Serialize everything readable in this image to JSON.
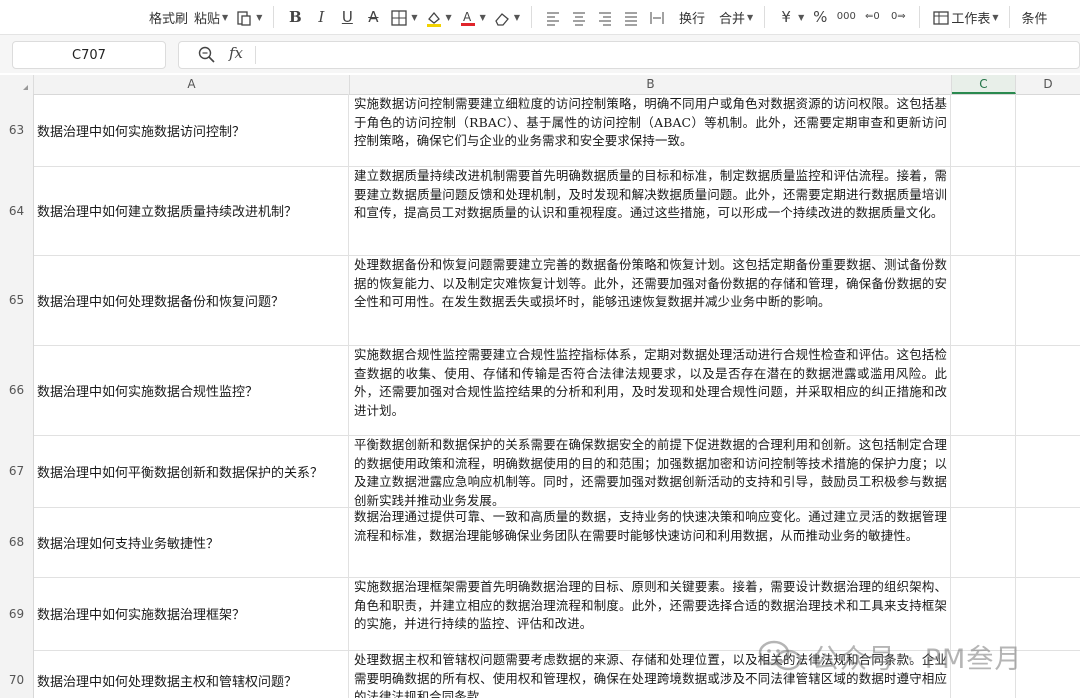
{
  "toolbar": {
    "format_painter": "格式刷",
    "paste": "粘贴",
    "wrap": "换行",
    "merge": "合并",
    "percent": "%",
    "worksheet": "工作表",
    "condition": "条件"
  },
  "formula_bar": {
    "name_box": "C707",
    "fx_label": "fx"
  },
  "columns": [
    "A",
    "B",
    "C",
    "D"
  ],
  "rows": [
    {
      "num": "63",
      "question": "数据治理中如何实施数据访问控制？",
      "answer": "实施数据访问控制需要建立细粒度的访问控制策略，明确不同用户或角色对数据资源的访问权限。这包括基于角色的访问控制（RBAC）、基于属性的访问控制（ABAC）等机制。此外，还需要定期审查和更新访问控制策略，确保它们与企业的业务需求和安全要求保持一致。"
    },
    {
      "num": "64",
      "question": "数据治理中如何建立数据质量持续改进机制？",
      "answer": "建立数据质量持续改进机制需要首先明确数据质量的目标和标准，制定数据质量监控和评估流程。接着，需要建立数据质量问题反馈和处理机制，及时发现和解决数据质量问题。此外，还需要定期进行数据质量培训和宣传，提高员工对数据质量的认识和重视程度。通过这些措施，可以形成一个持续改进的数据质量文化。"
    },
    {
      "num": "65",
      "question": "数据治理中如何处理数据备份和恢复问题？",
      "answer": "处理数据备份和恢复问题需要建立完善的数据备份策略和恢复计划。这包括定期备份重要数据、测试备份数据的恢复能力、以及制定灾难恢复计划等。此外，还需要加强对备份数据的存储和管理，确保备份数据的安全性和可用性。在发生数据丢失或损坏时，能够迅速恢复数据并减少业务中断的影响。"
    },
    {
      "num": "66",
      "question": "数据治理中如何实施数据合规性监控？",
      "answer": "实施数据合规性监控需要建立合规性监控指标体系，定期对数据处理活动进行合规性检查和评估。这包括检查数据的收集、使用、存储和传输是否符合法律法规要求，以及是否存在潜在的数据泄露或滥用风险。此外，还需要加强对合规性监控结果的分析和利用，及时发现和处理合规性问题，并采取相应的纠正措施和改进计划。"
    },
    {
      "num": "67",
      "question": "数据治理中如何平衡数据创新和数据保护的关系？",
      "answer": "平衡数据创新和数据保护的关系需要在确保数据安全的前提下促进数据的合理利用和创新。这包括制定合理的数据使用政策和流程，明确数据使用的目的和范围；加强数据加密和访问控制等技术措施的保护力度；以及建立数据泄露应急响应机制等。同时，还需要加强对数据创新活动的支持和引导，鼓励员工积极参与数据创新实践并推动业务发展。"
    },
    {
      "num": "68",
      "question": "数据治理如何支持业务敏捷性？",
      "answer": "数据治理通过提供可靠、一致和高质量的数据，支持业务的快速决策和响应变化。通过建立灵活的数据管理流程和标准，数据治理能够确保业务团队在需要时能够快速访问和利用数据，从而推动业务的敏捷性。"
    },
    {
      "num": "69",
      "question": "数据治理中如何实施数据治理框架？",
      "answer": "实施数据治理框架需要首先明确数据治理的目标、原则和关键要素。接着，需要设计数据治理的组织架构、角色和职责，并建立相应的数据治理流程和制度。此外，还需要选择合适的数据治理技术和工具来支持框架的实施，并进行持续的监控、评估和改进。"
    },
    {
      "num": "70",
      "question": "数据治理中如何处理数据主权和管辖权问题？",
      "answer": "处理数据主权和管辖权问题需要考虑数据的来源、存储和处理位置，以及相关的法律法规和合同条款。企业需要明确数据的所有权、使用权和管理权，确保在处理跨境数据或涉及不同法律管辖区域的数据时遵守相应的法律法规和合同条款。"
    }
  ],
  "watermark": {
    "text": "公众号 · PM叁月"
  }
}
